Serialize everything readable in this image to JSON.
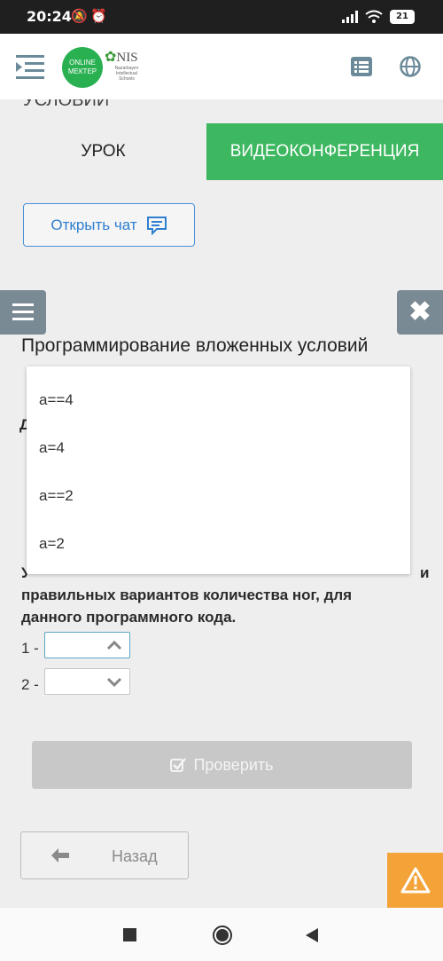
{
  "status_bar": {
    "time": "20:24",
    "battery": "21"
  },
  "header": {
    "logo_online": "ONLINE",
    "logo_mektep": "МЕКТЕР",
    "nis_label": "NIS",
    "nis_sub1": "Nazarbayev",
    "nis_sub2": "Intellectual",
    "nis_sub3": "Schools"
  },
  "partial_heading": "УСЛОВИЙ",
  "tabs": {
    "lesson": "УРОК",
    "video": "ВИДЕОКОНФЕРЕНЦИЯ"
  },
  "chat_button": "Открыть чат",
  "lesson_title": "Программирование вложенных условий",
  "partial_letter": "Д",
  "dropdown_options": [
    "a==4",
    "a=4",
    "a==2",
    "a=2"
  ],
  "question": {
    "line1_partial": "У",
    "line1_end": "и",
    "line2": "правильных вариантов количества ног, для",
    "line3": "данного программного кода."
  },
  "selects": [
    {
      "label": "1 -",
      "value": ""
    },
    {
      "label": "2 -",
      "value": ""
    }
  ],
  "check_button": "Проверить",
  "back_button": "Назад",
  "colors": {
    "green": "#3db760",
    "blue": "#2f7fd0",
    "warning": "#f4a338",
    "gray_button": "#7a8a94"
  }
}
